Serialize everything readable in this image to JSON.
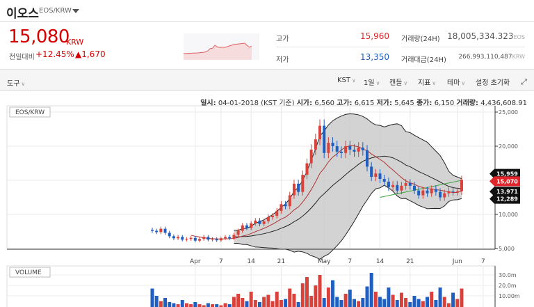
{
  "header": {
    "coin_name": "이오스",
    "pair": "EOS/KRW"
  },
  "price": {
    "value": "15,080",
    "unit": "KRW",
    "change_label": "전일대비",
    "change_pct": "+12.45%",
    "change_abs": "▲1,670"
  },
  "stats": {
    "high_label": "고가",
    "high": "15,960",
    "low_label": "저가",
    "low": "13,350",
    "volume_label": "거래량(24H)",
    "volume": "18,005,334.323",
    "volume_unit": "EOS",
    "amount_label": "거래대금(24H)",
    "amount": "266,993,110,487",
    "amount_unit": "KRW"
  },
  "toolbar": {
    "tools": "도구",
    "items": [
      "KST",
      "1일",
      "캔들",
      "지표",
      "테마"
    ],
    "reset": "설정 초기화"
  },
  "info": {
    "date_label": "일시:",
    "date": "04-01-2018 (KST 기준)",
    "open_label": "시가:",
    "open": "6,560",
    "high_label": "고가:",
    "high": "6,615",
    "low_label": "저가:",
    "low": "5,645",
    "close_label": "종가:",
    "close": "6,150",
    "vol_label": "거래량:",
    "vol": "4,436,608.91"
  },
  "colors": {
    "up": "#d9413a",
    "down": "#1f5fc2",
    "accent": "#e0262b"
  },
  "chart_data": {
    "type": "candlestick",
    "title": "EOS/KRW",
    "volume_title": "VOLUME",
    "start_date": "2018-03-22",
    "closes": [
      7600,
      7400,
      7900,
      7300,
      6800,
      6500,
      6700,
      6300,
      6400,
      6560,
      6150,
      6400,
      6700,
      6300,
      6400,
      6200,
      6500,
      6700,
      6500,
      7000,
      7600,
      8400,
      8000,
      8700,
      9100,
      8600,
      9000,
      9600,
      9800,
      10500,
      11500,
      11200,
      12800,
      14500,
      13300,
      15800,
      17500,
      19500,
      21000,
      23000,
      19000,
      20500,
      20000,
      19200,
      19000,
      20000,
      19500,
      19200,
      19800,
      19400,
      17000,
      15500,
      16000,
      15200,
      14800,
      14000,
      14300,
      13500,
      14200,
      14600,
      14200,
      13500,
      12800,
      13500,
      13100,
      13700,
      13300,
      12500,
      13100,
      13400,
      13300,
      13410,
      15070
    ],
    "volumes_m": [
      17,
      10,
      5,
      8,
      4,
      3,
      2,
      6,
      3,
      2,
      4,
      2,
      1,
      3,
      2,
      2,
      1,
      3,
      2,
      9,
      12,
      8,
      5,
      14,
      6,
      4,
      9,
      11,
      5,
      14,
      6,
      7,
      17,
      12,
      4,
      22,
      28,
      10,
      20,
      30,
      8,
      18,
      25,
      9,
      6,
      12,
      16,
      7,
      5,
      8,
      19,
      32,
      14,
      9,
      7,
      18,
      11,
      6,
      13,
      8,
      4,
      10,
      7,
      5,
      9,
      14,
      6,
      18,
      9,
      3,
      13,
      7,
      17
    ],
    "y_ticks": [
      "25,000",
      "20,000",
      "15,000",
      "10,000",
      "5,000"
    ],
    "y_tick_values": [
      25000,
      20000,
      15000,
      10000,
      5000
    ],
    "ylim": [
      5000,
      26000
    ],
    "x_ticks": [
      {
        "label": "Apr",
        "day": 10
      },
      {
        "label": "7",
        "day": 16
      },
      {
        "label": "14",
        "day": 23
      },
      {
        "label": "21",
        "day": 30
      },
      {
        "label": "May",
        "day": 40
      },
      {
        "label": "7",
        "day": 46
      },
      {
        "label": "14",
        "day": 53
      },
      {
        "label": "21",
        "day": 60
      },
      {
        "label": "Jun",
        "day": 71
      },
      {
        "label": "7",
        "day": 77
      }
    ],
    "vol_ticks": [
      "30.0m",
      "20.0m",
      "10.00m"
    ],
    "vol_tick_values": [
      30,
      20,
      10
    ],
    "price_labels": [
      {
        "text": "15,959",
        "value": 15959,
        "color": "#111"
      },
      {
        "text": "15,070",
        "value": 15070,
        "color": "#e0262b"
      },
      {
        "text": "13,971",
        "value": 13971,
        "color": "#111"
      },
      {
        "text": "12,289",
        "value": 12289,
        "color": "#111"
      }
    ],
    "trendline": [
      {
        "day": 53,
        "price": 12500
      },
      {
        "day": 72,
        "price": 15000
      }
    ]
  }
}
